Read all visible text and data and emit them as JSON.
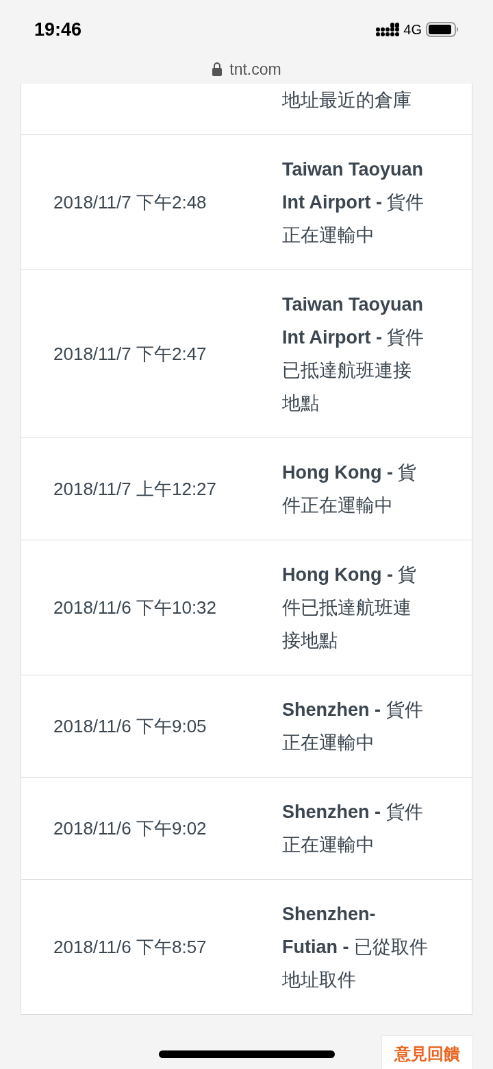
{
  "status_bar": {
    "time": "19:46",
    "network": "4G"
  },
  "address_bar": {
    "url": "tnt.com"
  },
  "events": [
    {
      "description": "地址最近的倉庫"
    },
    {
      "date": "2018/11/7 下午2:48",
      "description": "**Taiwan Taoyuan Int Airport -** 貨件正在運輸中"
    },
    {
      "date": "2018/11/7 下午2:47",
      "description": "**Taiwan Taoyuan Int Airport -** 貨件已抵達航班連接地點"
    },
    {
      "date": "2018/11/7 上午12:27",
      "description": "**Hong Kong -** 貨件正在運輸中"
    },
    {
      "date": "2018/11/6 下午10:32",
      "description": "**Hong Kong -** 貨件已抵達航班連接地點"
    },
    {
      "date": "2018/11/6 下午9:05",
      "description": "**Shenzhen -** 貨件正在運輸中"
    },
    {
      "date": "2018/11/6 下午9:02",
      "description": "**Shenzhen -** 貨件正在運輸中"
    },
    {
      "date": "2018/11/6 下午8:57",
      "description": "**Shenzhen-Futian -** 已從取件地址取件"
    }
  ],
  "feedback_button": {
    "label": "意見回饋"
  }
}
